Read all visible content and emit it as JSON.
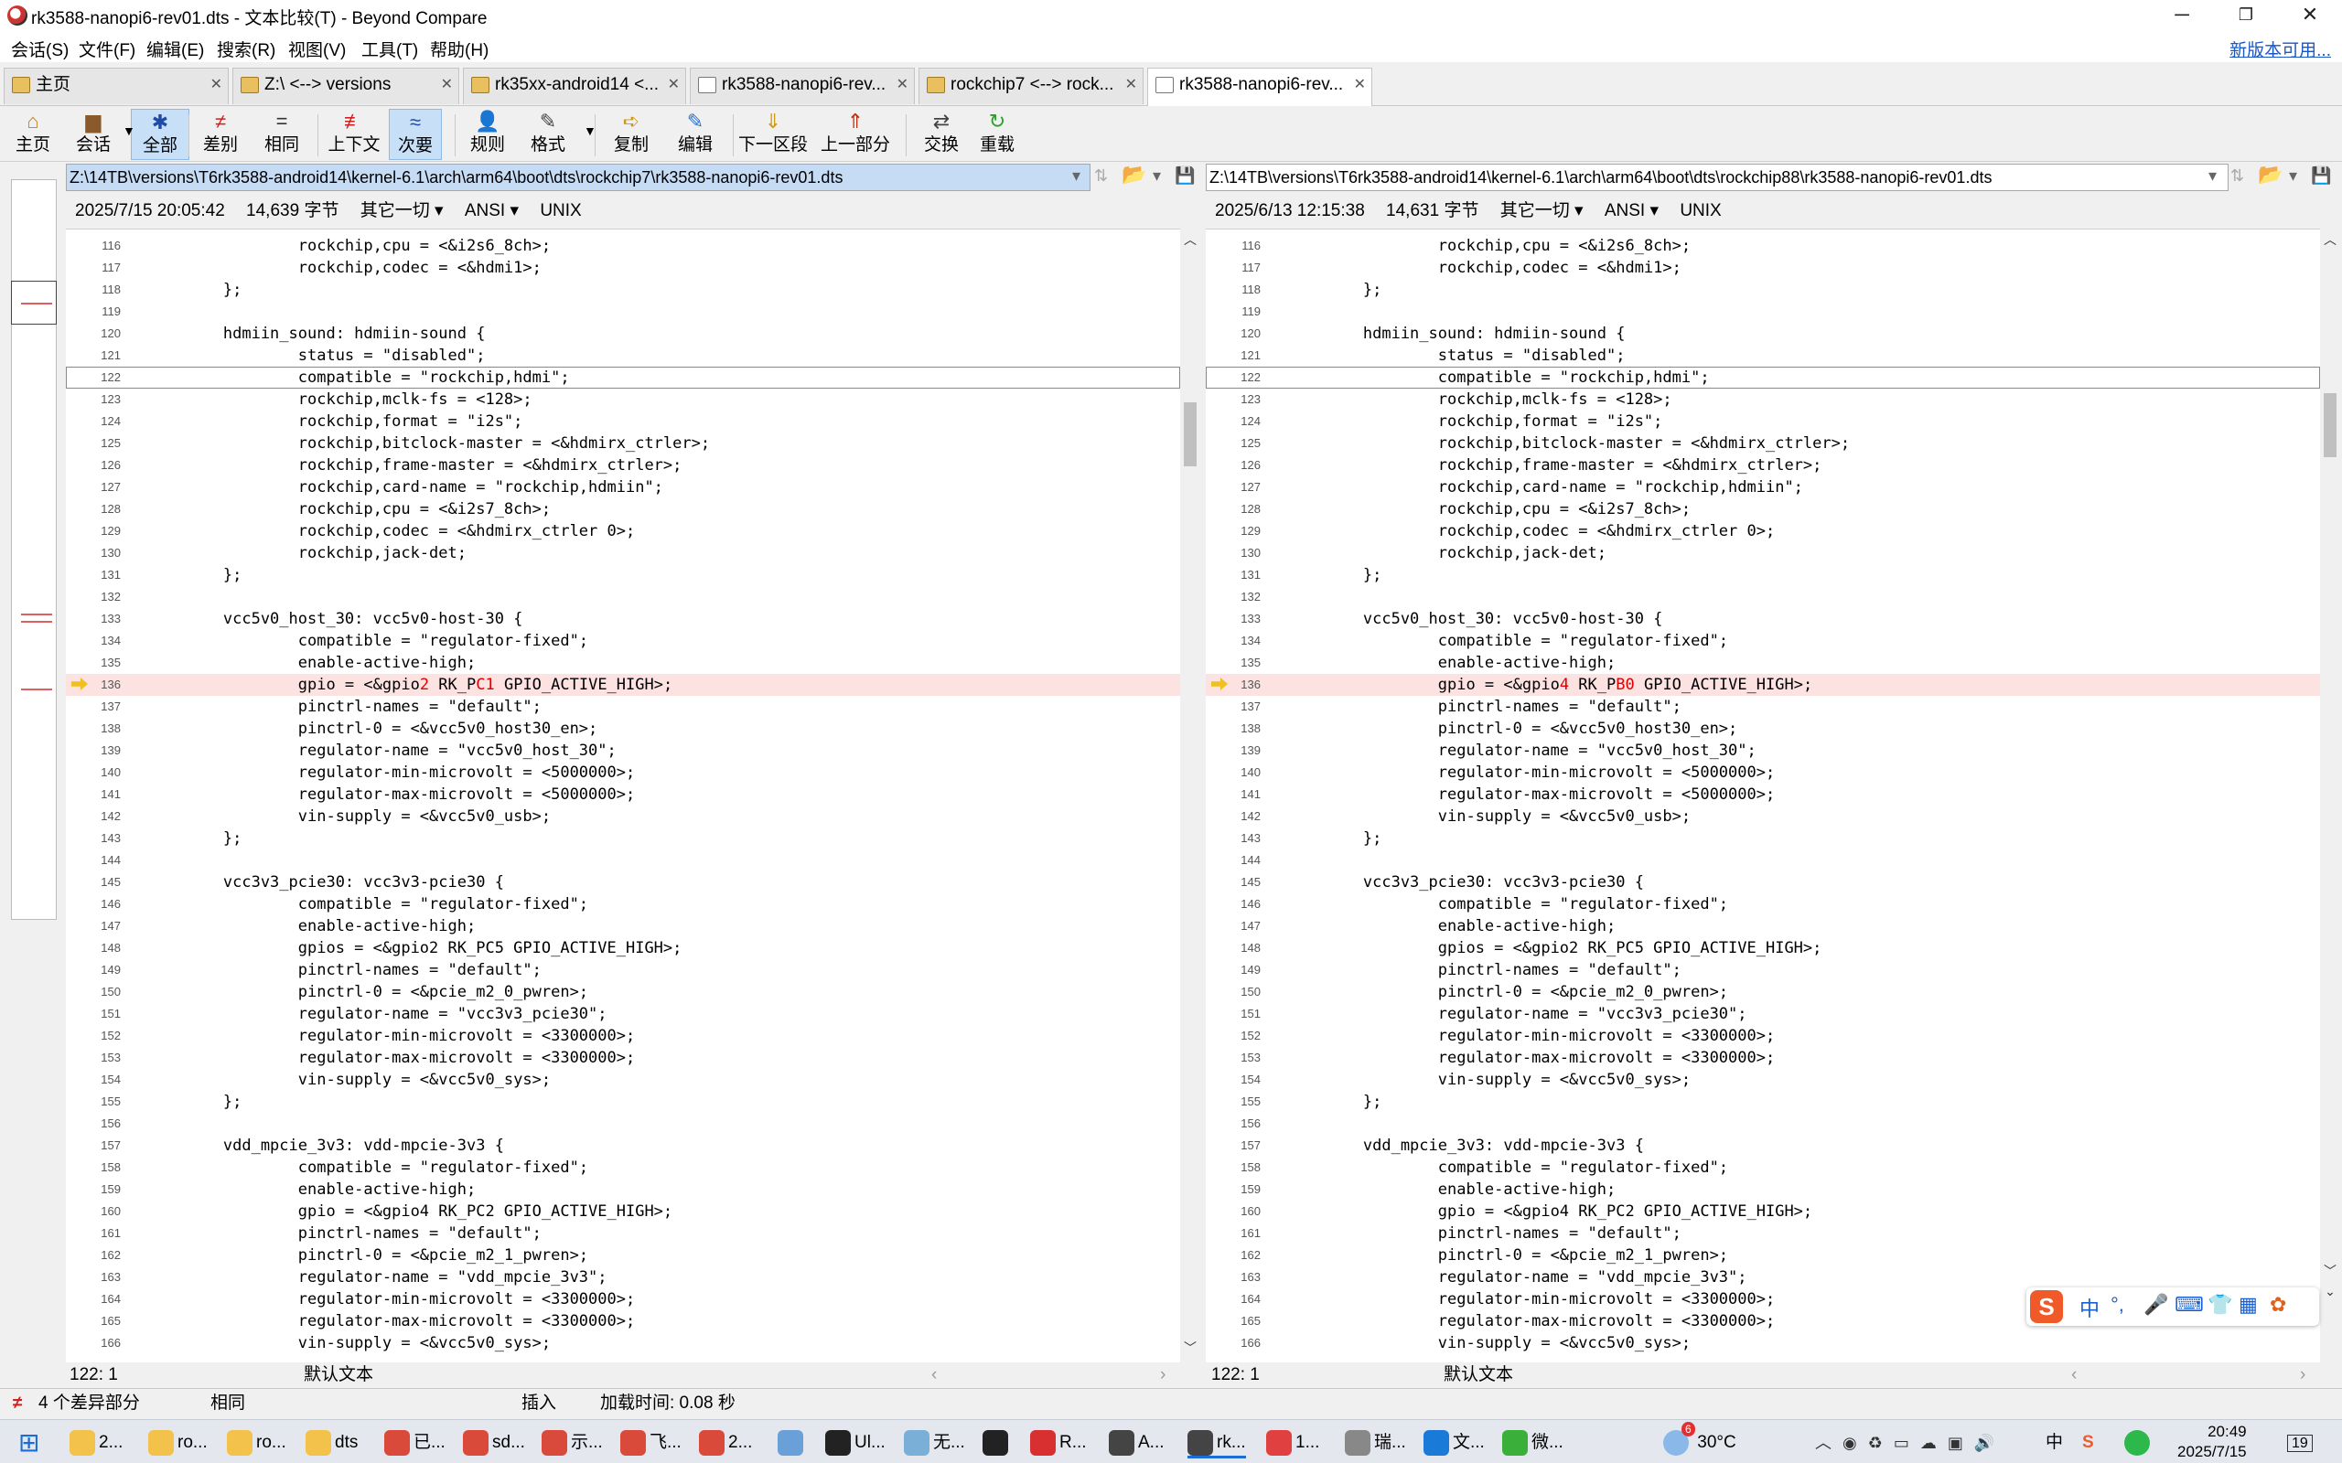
{
  "window": {
    "title": "rk3588-nanopi6-rev01.dts - 文本比较(T) - Beyond Compare",
    "min": "─",
    "max": "❐",
    "close": "✕"
  },
  "menu": [
    "会话(S)",
    "文件(F)",
    "编辑(E)",
    "搜索(R)",
    "视图(V)",
    "工具(T)",
    "帮助(H)"
  ],
  "new_version": "新版本可用...",
  "tabs": [
    {
      "label": "主页",
      "active": false
    },
    {
      "label": "Z:\\ <--> versions",
      "active": false
    },
    {
      "label": "rk35xx-android14 <...",
      "active": false
    },
    {
      "label": "rk3588-nanopi6-rev...",
      "active": false
    },
    {
      "label": "rockchip7 <--> rock...",
      "active": false
    },
    {
      "label": "rk3588-nanopi6-rev...",
      "active": true
    }
  ],
  "toolbar": [
    {
      "label": "主页",
      "icon": "home-icon",
      "glyph": "⌂",
      "color": "#c07d20"
    },
    {
      "label": "会话",
      "icon": "session-icon",
      "glyph": "▆",
      "color": "#8a5a2a"
    },
    {
      "label": "全部",
      "icon": "all-icon",
      "glyph": "✱",
      "color": "#1f4aa8",
      "active": true
    },
    {
      "label": "差别",
      "icon": "diff-icon",
      "glyph": "≠",
      "color": "#d02020"
    },
    {
      "label": "相同",
      "icon": "same-icon",
      "glyph": "=",
      "color": "#333333"
    },
    {
      "label": "上下文",
      "icon": "context-icon",
      "glyph": "≢",
      "color": "#d02020"
    },
    {
      "label": "次要",
      "icon": "minor-icon",
      "glyph": "≈",
      "color": "#1f4aa8",
      "active": true
    },
    {
      "label": "规则",
      "icon": "rules-icon",
      "glyph": "👤",
      "color": "#444"
    },
    {
      "label": "格式",
      "icon": "format-icon",
      "glyph": "✎",
      "color": "#444"
    },
    {
      "label": "复制",
      "icon": "copy-icon",
      "glyph": "➪",
      "color": "#d09a10"
    },
    {
      "label": "编辑",
      "icon": "edit-icon",
      "glyph": "✎",
      "color": "#2a6fcf"
    },
    {
      "label": "下一区段",
      "icon": "next-section-icon",
      "glyph": "⇓",
      "color": "#d09a10"
    },
    {
      "label": "上一部分",
      "icon": "prev-section-icon",
      "glyph": "⇑",
      "color": "#c03010"
    },
    {
      "label": "交换",
      "icon": "swap-icon",
      "glyph": "⇄",
      "color": "#444"
    },
    {
      "label": "重载",
      "icon": "reload-icon",
      "glyph": "↻",
      "color": "#2aa02a"
    }
  ],
  "left": {
    "path": "Z:\\14TB\\versions\\T6rk3588-android14\\kernel-6.1\\arch\\arm64\\boot\\dts\\rockchip7\\rk3588-nanopi6-rev01.dts",
    "date": "2025/7/15 20:05:42",
    "size": "14,639 字节",
    "other": "其它一切",
    "encoding": "ANSI",
    "eol": "UNIX",
    "cursor": "122: 1",
    "mode": "默认文本"
  },
  "right": {
    "path": "Z:\\14TB\\versions\\T6rk3588-android14\\kernel-6.1\\arch\\arm64\\boot\\dts\\rockchip88\\rk3588-nanopi6-rev01.dts",
    "date": "2025/6/13 12:15:38",
    "size": "14,631 字节",
    "other": "其它一切",
    "encoding": "ANSI",
    "eol": "UNIX",
    "cursor": "122: 1",
    "mode": "默认文本"
  },
  "lines": [
    {
      "n": "116",
      "t": "\t\trockchip,cpu = <&i2s6_8ch>;"
    },
    {
      "n": "117",
      "t": "\t\trockchip,codec = <&hdmi1>;"
    },
    {
      "n": "118",
      "t": "\t};"
    },
    {
      "n": "119",
      "t": ""
    },
    {
      "n": "120",
      "t": "\thdmiin_sound: hdmiin-sound {"
    },
    {
      "n": "121",
      "t": "\t\tstatus = \"disabled\";"
    },
    {
      "n": "122",
      "t": "\t\tcompatible = \"rockchip,hdmi\";",
      "cur": true
    },
    {
      "n": "123",
      "t": "\t\trockchip,mclk-fs = <128>;"
    },
    {
      "n": "124",
      "t": "\t\trockchip,format = \"i2s\";"
    },
    {
      "n": "125",
      "t": "\t\trockchip,bitclock-master = <&hdmirx_ctrler>;"
    },
    {
      "n": "126",
      "t": "\t\trockchip,frame-master = <&hdmirx_ctrler>;"
    },
    {
      "n": "127",
      "t": "\t\trockchip,card-name = \"rockchip,hdmiin\";"
    },
    {
      "n": "128",
      "t": "\t\trockchip,cpu = <&i2s7_8ch>;"
    },
    {
      "n": "129",
      "t": "\t\trockchip,codec = <&hdmirx_ctrler 0>;"
    },
    {
      "n": "130",
      "t": "\t\trockchip,jack-det;"
    },
    {
      "n": "131",
      "t": "\t};"
    },
    {
      "n": "132",
      "t": ""
    },
    {
      "n": "133",
      "t": "\tvcc5v0_host_30: vcc5v0-host-30 {"
    },
    {
      "n": "134",
      "t": "\t\tcompatible = \"regulator-fixed\";"
    },
    {
      "n": "135",
      "t": "\t\tenable-active-high;"
    },
    {
      "n": "136",
      "diff": true
    },
    {
      "n": "137",
      "t": "\t\tpinctrl-names = \"default\";"
    },
    {
      "n": "138",
      "t": "\t\tpinctrl-0 = <&vcc5v0_host30_en>;"
    },
    {
      "n": "139",
      "t": "\t\tregulator-name = \"vcc5v0_host_30\";"
    },
    {
      "n": "140",
      "t": "\t\tregulator-min-microvolt = <5000000>;"
    },
    {
      "n": "141",
      "t": "\t\tregulator-max-microvolt = <5000000>;"
    },
    {
      "n": "142",
      "t": "\t\tvin-supply = <&vcc5v0_usb>;"
    },
    {
      "n": "143",
      "t": "\t};"
    },
    {
      "n": "144",
      "t": ""
    },
    {
      "n": "145",
      "t": "\tvcc3v3_pcie30: vcc3v3-pcie30 {"
    },
    {
      "n": "146",
      "t": "\t\tcompatible = \"regulator-fixed\";"
    },
    {
      "n": "147",
      "t": "\t\tenable-active-high;"
    },
    {
      "n": "148",
      "t": "\t\tgpios = <&gpio2 RK_PC5 GPIO_ACTIVE_HIGH>;"
    },
    {
      "n": "149",
      "t": "\t\tpinctrl-names = \"default\";"
    },
    {
      "n": "150",
      "t": "\t\tpinctrl-0 = <&pcie_m2_0_pwren>;"
    },
    {
      "n": "151",
      "t": "\t\tregulator-name = \"vcc3v3_pcie30\";"
    },
    {
      "n": "152",
      "t": "\t\tregulator-min-microvolt = <3300000>;"
    },
    {
      "n": "153",
      "t": "\t\tregulator-max-microvolt = <3300000>;"
    },
    {
      "n": "154",
      "t": "\t\tvin-supply = <&vcc5v0_sys>;"
    },
    {
      "n": "155",
      "t": "\t};"
    },
    {
      "n": "156",
      "t": ""
    },
    {
      "n": "157",
      "t": "\tvdd_mpcie_3v3: vdd-mpcie-3v3 {"
    },
    {
      "n": "158",
      "t": "\t\tcompatible = \"regulator-fixed\";"
    },
    {
      "n": "159",
      "t": "\t\tenable-active-high;"
    },
    {
      "n": "160",
      "t": "\t\tgpio = <&gpio4 RK_PC2 GPIO_ACTIVE_HIGH>;"
    },
    {
      "n": "161",
      "t": "\t\tpinctrl-names = \"default\";"
    },
    {
      "n": "162",
      "t": "\t\tpinctrl-0 = <&pcie_m2_1_pwren>;"
    },
    {
      "n": "163",
      "t": "\t\tregulator-name = \"vdd_mpcie_3v3\";"
    },
    {
      "n": "164",
      "t": "\t\tregulator-min-microvolt = <3300000>;"
    },
    {
      "n": "165",
      "t": "\t\tregulator-max-microvolt = <3300000>;"
    },
    {
      "n": "166",
      "t": "\t\tvin-supply = <&vcc5v0_sys>;"
    }
  ],
  "diff_line": {
    "left": [
      "\t\tgpio = <&gpio",
      "2",
      " RK_P",
      "C1",
      " GPIO_ACTIVE_HIGH>;"
    ],
    "right": [
      "\t\tgpio = <&gpio",
      "4",
      " RK_P",
      "B0",
      " GPIO_ACTIVE_HIGH>;"
    ]
  },
  "status": {
    "diff_count": "4 个差异部分",
    "same": "相同",
    "insert": "插入",
    "load_time": "加载时间: 0.08 秒"
  },
  "taskbar": {
    "items": [
      {
        "label": "2...",
        "icon": "folder-icon",
        "color": "#f2c24a"
      },
      {
        "label": "ro...",
        "icon": "folder-icon",
        "color": "#f2c24a"
      },
      {
        "label": "ro...",
        "icon": "folder-icon",
        "color": "#f2c24a"
      },
      {
        "label": "dts",
        "icon": "folder-icon",
        "color": "#f2c24a"
      },
      {
        "label": "已...",
        "icon": "browser-icon",
        "color": "#d94a3a"
      },
      {
        "label": "sd...",
        "icon": "browser-icon",
        "color": "#d94a3a"
      },
      {
        "label": "示...",
        "icon": "browser-icon",
        "color": "#d94a3a"
      },
      {
        "label": "飞...",
        "icon": "browser-icon",
        "color": "#d94a3a"
      },
      {
        "label": "2...",
        "icon": "browser-icon",
        "color": "#d94a3a"
      },
      {
        "label": "",
        "icon": "paint-icon",
        "color": "#6aa0d8"
      },
      {
        "label": "Ul...",
        "icon": "ultraedit-icon",
        "color": "#222"
      },
      {
        "label": "无...",
        "icon": "notepad-icon",
        "color": "#7ab0d8"
      },
      {
        "label": "",
        "icon": "terminal-icon",
        "color": "#222"
      },
      {
        "label": "R...",
        "icon": "wps-icon",
        "color": "#d83030"
      },
      {
        "label": "A...",
        "icon": "beyond-compare-icon",
        "color": "#444"
      },
      {
        "label": "rk...",
        "icon": "beyond-compare-icon",
        "color": "#444",
        "active": true
      },
      {
        "label": "1...",
        "icon": "app-icon",
        "color": "#e04040"
      },
      {
        "label": "瑞...",
        "icon": "tool-icon",
        "color": "#888"
      },
      {
        "label": "文...",
        "icon": "edge-icon",
        "color": "#1a7ad8"
      },
      {
        "label": "微...",
        "icon": "wechat-icon",
        "color": "#3ab03a"
      }
    ],
    "weather": "30°C",
    "weather_badge": "6",
    "ime_lang": "中",
    "time": "20:49",
    "date": "2025/7/15",
    "notif": "19"
  },
  "ime_float": {
    "logo": "S",
    "lang": "中"
  }
}
